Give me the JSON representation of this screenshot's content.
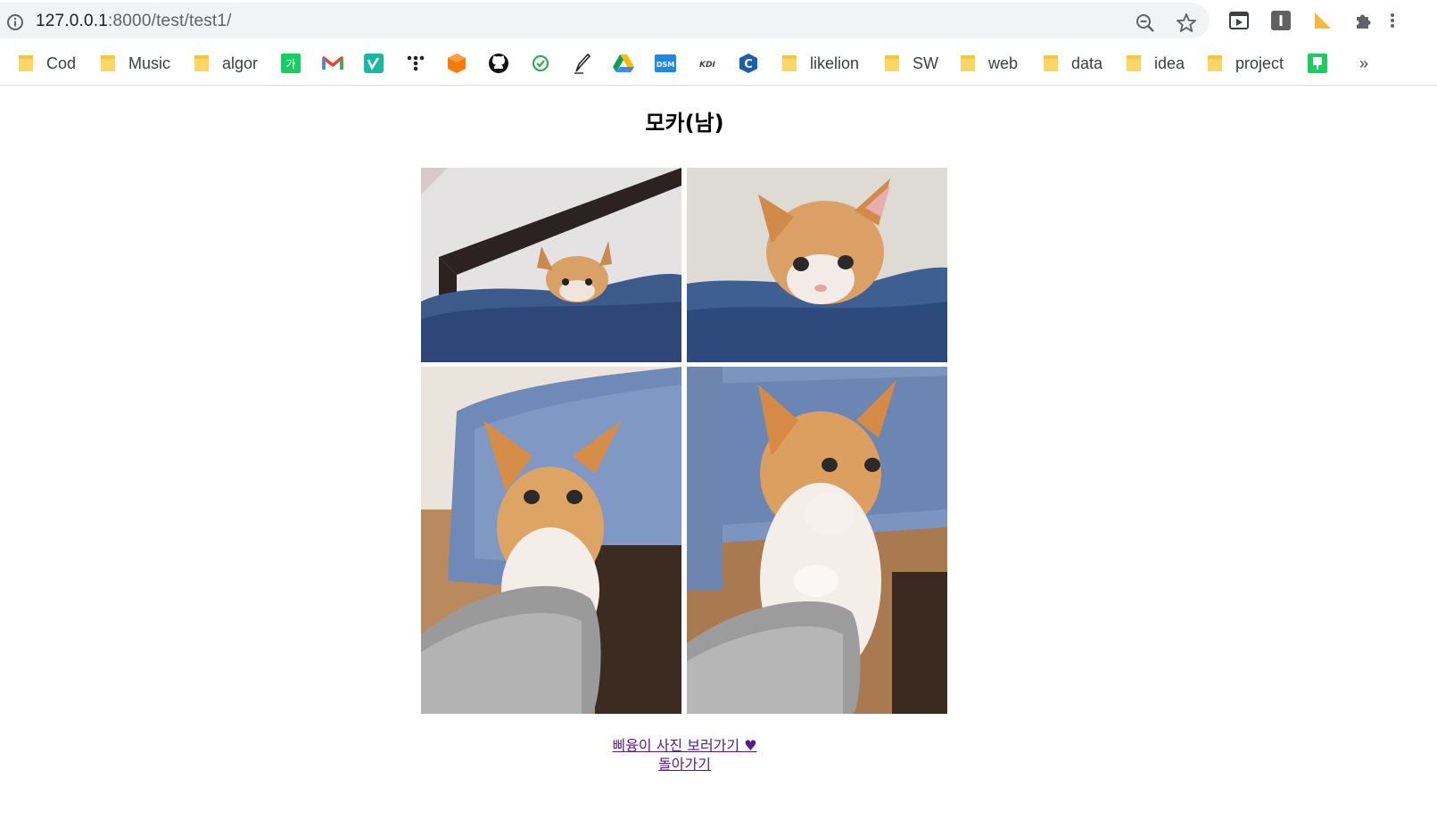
{
  "browser": {
    "url_host": "127.0.0.1",
    "url_path": ":8000/test/test1/"
  },
  "bookmarks": {
    "folders": [
      "Cod",
      "Music",
      "algor",
      "likelion",
      "SW",
      "web",
      "data",
      "idea",
      "project"
    ],
    "more": "»",
    "icons": [
      "naver-icon",
      "gmail-icon",
      "vimeo-icon",
      "dots-icon",
      "cube-icon",
      "github-icon",
      "refresh-icon",
      "pen-icon",
      "drive-icon",
      "dsm-icon",
      "kdi-icon",
      "c-icon",
      "green-icon"
    ]
  },
  "page": {
    "title": "모카(남)",
    "link_pictures": "삐융이 사진 보러가기 ♥",
    "link_back": "돌아가기"
  },
  "colors": {
    "link": "#551a8b",
    "folder": "#fdd663"
  }
}
